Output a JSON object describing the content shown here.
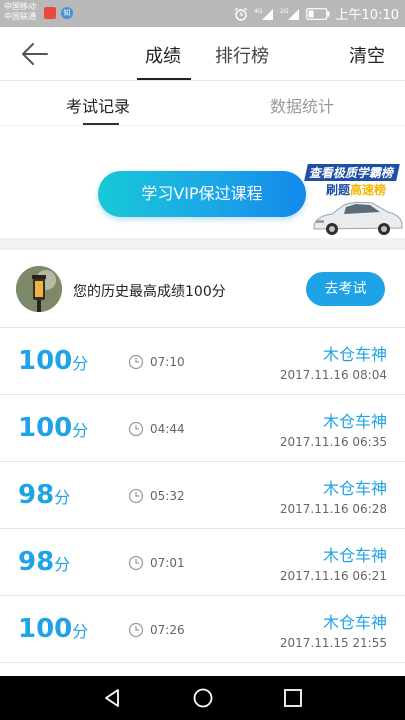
{
  "status_bar": {
    "carrier1": "中国移动",
    "carrier2": "中国联通",
    "badge1": "",
    "badge2": "知",
    "network1": "4G",
    "network2": "2G",
    "time": "上午10:10"
  },
  "header": {
    "tab_score": "成绩",
    "tab_rank": "排行榜",
    "clear": "清空"
  },
  "subtabs": {
    "records": "考试记录",
    "stats": "数据统计"
  },
  "banner": {
    "vip_button": "学习VIP保过课程",
    "ad_line1": "查看极质学霸榜",
    "ad_line2_a": "刷题",
    "ad_line2_b": "高速榜"
  },
  "history": {
    "text": "您的历史最高成绩100分",
    "button": "去考试"
  },
  "records": [
    {
      "score": "100",
      "unit": "分",
      "duration": "07:10",
      "driver": "木仓车神",
      "datetime": "2017.11.16  08:04"
    },
    {
      "score": "100",
      "unit": "分",
      "duration": "04:44",
      "driver": "木仓车神",
      "datetime": "2017.11.16  06:35"
    },
    {
      "score": "98",
      "unit": "分",
      "duration": "05:32",
      "driver": "木仓车神",
      "datetime": "2017.11.16  06:28"
    },
    {
      "score": "98",
      "unit": "分",
      "duration": "07:01",
      "driver": "木仓车神",
      "datetime": "2017.11.16  06:21"
    },
    {
      "score": "100",
      "unit": "分",
      "duration": "07:26",
      "driver": "木仓车神",
      "datetime": "2017.11.15  21:55"
    }
  ],
  "colors": {
    "accent": "#1fa3e6",
    "status_bar": "#b9b9b9",
    "nav_bar": "#000000"
  },
  "icons": {
    "back": "arrow-left-icon",
    "clock": "clock-icon",
    "nav_back": "triangle-back-icon",
    "nav_home": "circle-home-icon",
    "nav_recent": "square-recent-icon"
  }
}
